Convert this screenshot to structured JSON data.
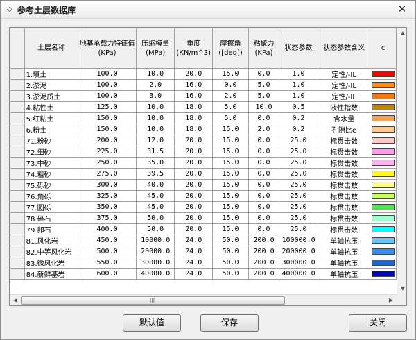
{
  "window": {
    "title": "参考土层数据库",
    "menu_icon": "◇",
    "close_glyph": "✕"
  },
  "table": {
    "headers": {
      "name": "土层名称",
      "bearing": "地基承载力特征值 (KPa)",
      "modulus": "压缩模量 (MPa)",
      "weight": "重度 (KN/m^3)",
      "friction": "摩擦角 ([deg])",
      "cohesion": "粘聚力 (KPa)",
      "state": "状态参数",
      "meaning": "状态参数含义",
      "color": "c"
    },
    "rows": [
      {
        "name": "1.填土",
        "bearing": "100.0",
        "modulus": "10.0",
        "weight": "20.0",
        "friction": "15.0",
        "cohesion": "0.0",
        "state": "1.0",
        "meaning": "定性/-IL",
        "color": "#ff0000"
      },
      {
        "name": "2.淤泥",
        "bearing": "100.0",
        "modulus": "2.0",
        "weight": "16.0",
        "friction": "0.0",
        "cohesion": "5.0",
        "state": "1.0",
        "meaning": "定性/-IL",
        "color": "#ff8c1a"
      },
      {
        "name": "3.淤泥质土",
        "bearing": "100.0",
        "modulus": "3.0",
        "weight": "16.0",
        "friction": "2.0",
        "cohesion": "5.0",
        "state": "1.0",
        "meaning": "定性/-IL",
        "color": "#f07a10"
      },
      {
        "name": "4.粘性土",
        "bearing": "125.0",
        "modulus": "10.0",
        "weight": "18.0",
        "friction": "5.0",
        "cohesion": "10.0",
        "state": "0.5",
        "meaning": "液性指数",
        "color": "#b8860b"
      },
      {
        "name": "5.红粘土",
        "bearing": "150.0",
        "modulus": "10.0",
        "weight": "18.0",
        "friction": "5.0",
        "cohesion": "0.0",
        "state": "0.2",
        "meaning": "含水量",
        "color": "#f9a04a"
      },
      {
        "name": "6.粉土",
        "bearing": "150.0",
        "modulus": "10.0",
        "weight": "18.0",
        "friction": "15.0",
        "cohesion": "2.0",
        "state": "0.2",
        "meaning": "孔隙比e",
        "color": "#ffc890"
      },
      {
        "name": "71.粉砂",
        "bearing": "200.0",
        "modulus": "12.0",
        "weight": "20.0",
        "friction": "15.0",
        "cohesion": "0.0",
        "state": "25.0",
        "meaning": "标贯击数",
        "color": "#ffc8c8"
      },
      {
        "name": "72.细砂",
        "bearing": "225.0",
        "modulus": "31.5",
        "weight": "20.0",
        "friction": "15.0",
        "cohesion": "0.0",
        "state": "25.0",
        "meaning": "标贯击数",
        "color": "#ff9be8"
      },
      {
        "name": "73.中砂",
        "bearing": "250.0",
        "modulus": "35.0",
        "weight": "20.0",
        "friction": "15.0",
        "cohesion": "0.0",
        "state": "25.0",
        "meaning": "标贯击数",
        "color": "#ffb0f0"
      },
      {
        "name": "74.粗砂",
        "bearing": "275.0",
        "modulus": "39.5",
        "weight": "20.0",
        "friction": "15.0",
        "cohesion": "0.0",
        "state": "25.0",
        "meaning": "标贯击数",
        "color": "#ffff00"
      },
      {
        "name": "75.砾砂",
        "bearing": "300.0",
        "modulus": "40.0",
        "weight": "20.0",
        "friction": "15.0",
        "cohesion": "0.0",
        "state": "25.0",
        "meaning": "标贯击数",
        "color": "#ffff90"
      },
      {
        "name": "76.角砾",
        "bearing": "325.0",
        "modulus": "45.0",
        "weight": "20.0",
        "friction": "15.0",
        "cohesion": "0.0",
        "state": "25.0",
        "meaning": "标贯击数",
        "color": "#c8ff64"
      },
      {
        "name": "77.圆砾",
        "bearing": "350.0",
        "modulus": "45.0",
        "weight": "20.0",
        "friction": "15.0",
        "cohesion": "0.0",
        "state": "25.0",
        "meaning": "标贯击数",
        "color": "#50e050"
      },
      {
        "name": "78.碎石",
        "bearing": "375.0",
        "modulus": "50.0",
        "weight": "20.0",
        "friction": "15.0",
        "cohesion": "0.0",
        "state": "25.0",
        "meaning": "标贯击数",
        "color": "#a0ffd0"
      },
      {
        "name": "79.卵石",
        "bearing": "400.0",
        "modulus": "50.0",
        "weight": "20.0",
        "friction": "15.0",
        "cohesion": "0.0",
        "state": "25.0",
        "meaning": "标贯击数",
        "color": "#00ffff"
      },
      {
        "name": "81.风化岩",
        "bearing": "450.0",
        "modulus": "10000.0",
        "weight": "24.0",
        "friction": "50.0",
        "cohesion": "200.0",
        "state": "100000.0",
        "meaning": "单轴抗压",
        "color": "#64c8ff"
      },
      {
        "name": "82.中等风化岩",
        "bearing": "500.0",
        "modulus": "20000.0",
        "weight": "24.0",
        "friction": "50.0",
        "cohesion": "200.0",
        "state": "200000.0",
        "meaning": "单轴抗压",
        "color": "#3c8ce8"
      },
      {
        "name": "83.微风化岩",
        "bearing": "550.0",
        "modulus": "30000.0",
        "weight": "24.0",
        "friction": "50.0",
        "cohesion": "200.0",
        "state": "300000.0",
        "meaning": "单轴抗压",
        "color": "#1e64d2"
      },
      {
        "name": "84.新鲜基岩",
        "bearing": "600.0",
        "modulus": "40000.0",
        "weight": "24.0",
        "friction": "50.0",
        "cohesion": "200.0",
        "state": "400000.0",
        "meaning": "单轴抗压",
        "color": "#0000c8"
      }
    ]
  },
  "scrollbar": {
    "grip": "III",
    "left_arrow": "◀",
    "right_arrow": "▶",
    "up_arrow": "▲",
    "down_arrow": "▼"
  },
  "buttons": {
    "default": "默认值",
    "save": "保存",
    "close": "关闭"
  }
}
